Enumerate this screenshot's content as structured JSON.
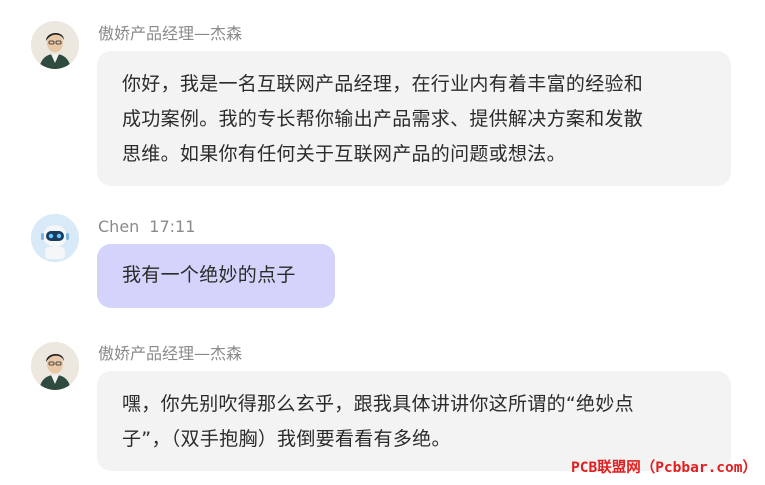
{
  "messages": [
    {
      "sender": "傲娇产品经理—杰森",
      "time": "",
      "avatar": "man-portrait-avatar",
      "lines": [
        "你好，我是一名互联网产品经理，在行业内有着丰富的经验和",
        "成功案例。我的专长帮你输出产品需求、提供解决方案和发散",
        "思维。如果你有任何关于互联网产品的问题或想法。"
      ]
    },
    {
      "sender": "Chen",
      "time": "17:11",
      "avatar": "robot-avatar",
      "lines": [
        "我有一个绝妙的点子"
      ]
    },
    {
      "sender": "傲娇产品经理—杰森",
      "time": "",
      "avatar": "man-portrait-avatar",
      "lines": [
        "嘿，你先别吹得那么玄乎，跟我具体讲讲你这所谓的“绝妙点",
        "子”，（双手抱胸）我倒要看看有多绝。"
      ]
    }
  ],
  "colors": {
    "bot_bubble": "#f3f3f4",
    "user_bubble": "#d3d3fb",
    "watermark": "#e02020"
  },
  "watermark": "PCB联盟网（Pcbbar.com）"
}
